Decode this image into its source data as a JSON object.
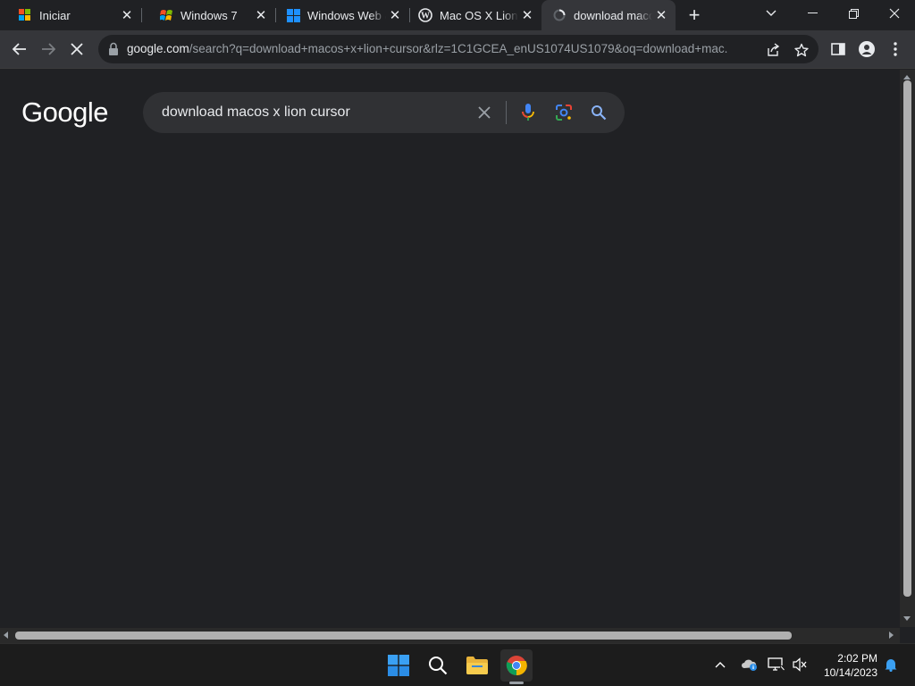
{
  "browser": {
    "tabs": [
      {
        "title": "Iniciar",
        "icon": "windows-flag-icon",
        "active": false
      },
      {
        "title": "Windows 7",
        "icon": "windows7-flag-icon",
        "active": false
      },
      {
        "title": "Windows Web & Mobile",
        "icon": "windows-logo-icon",
        "active": false
      },
      {
        "title": "Mac OS X Lion Cursor",
        "icon": "wordpress-icon",
        "active": false
      },
      {
        "title": "download macos x lion cursor",
        "icon": "loading-icon",
        "active": true
      }
    ],
    "address": {
      "host": "google.com",
      "path": "/search?q=download+macos+x+lion+cursor&rlz=1C1GCEA_enUS1074US1079&oq=download+mac..."
    }
  },
  "page": {
    "logo": "Google",
    "search_query": "download macos x lion cursor"
  },
  "taskbar": {
    "time": "2:02 PM",
    "date": "10/14/2023"
  },
  "colors": {
    "page_bg": "#202124",
    "toolbar_bg": "#35363a",
    "searchbox_bg": "#303134",
    "taskbar_bg": "#1c1c1c"
  }
}
